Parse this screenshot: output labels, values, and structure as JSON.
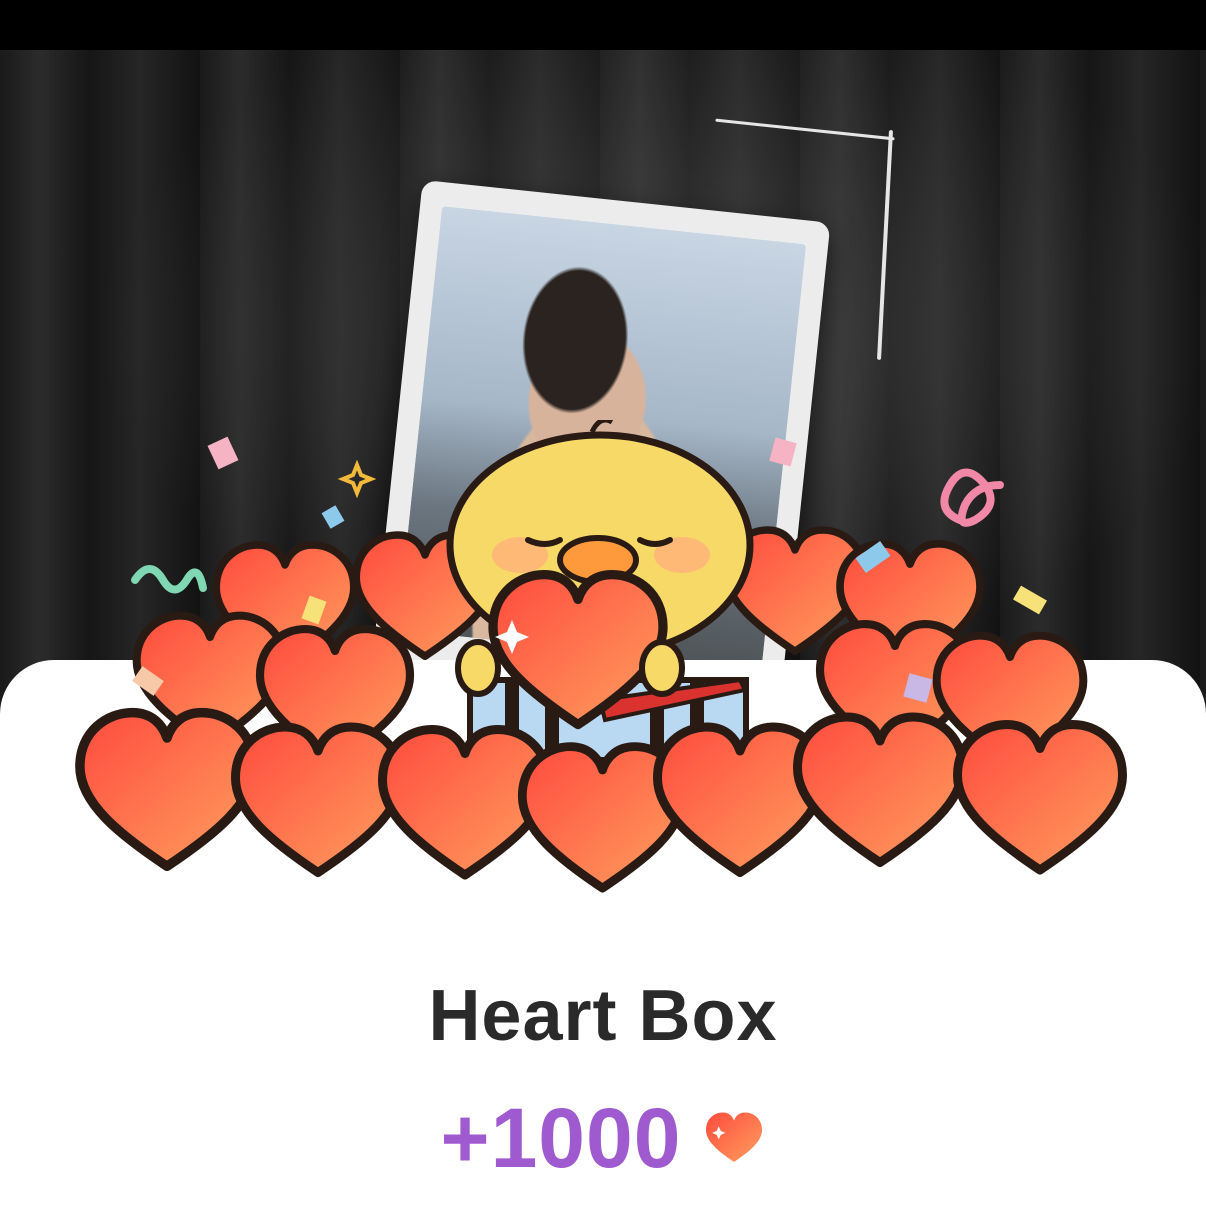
{
  "title": "Heart Box",
  "reward": {
    "amount": "+1000",
    "icon": "heart-icon"
  },
  "colors": {
    "title": "#2a2a2a",
    "reward": "#9f5ad0",
    "heart_start": "#ff4d3d",
    "heart_end": "#ff9a5a",
    "chick": "#f7d968"
  }
}
